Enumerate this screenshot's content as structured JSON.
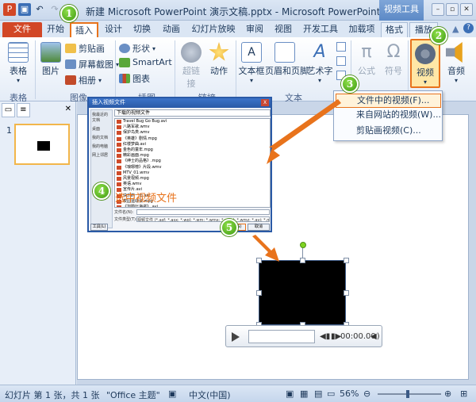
{
  "titlebar": {
    "title": "新建 Microsoft PowerPoint 演示文稿.pptx - Microsoft PowerPoint (试用",
    "context_tab": "视频工具"
  },
  "tabs": [
    "文件",
    "开始",
    "插入",
    "设计",
    "切换",
    "动画",
    "幻灯片放映",
    "审阅",
    "视图",
    "开发工具",
    "加载项",
    "格式",
    "播放"
  ],
  "ribbon": {
    "tables": {
      "btn": "表格",
      "group": "表格"
    },
    "images": {
      "picture": "图片",
      "clipart": "剪贴画",
      "screenshot": "屏幕截图",
      "album": "相册",
      "group": "图像"
    },
    "illustrations": {
      "shapes": "形状",
      "smartart": "SmartArt",
      "chart": "图表",
      "group": "插图"
    },
    "links": {
      "hyperlink": "超链接",
      "action": "动作",
      "group": "链接"
    },
    "text": {
      "textbox": "文本框",
      "header_footer": "页眉和页脚",
      "wordart": "艺术字",
      "group": "文本"
    },
    "symbols": {
      "equation": "公式",
      "symbol": "符号"
    },
    "media": {
      "video": "视频",
      "audio": "音频"
    }
  },
  "video_menu": [
    "文件中的视频(F)...",
    "来自网站的视频(W)...",
    "剪贴画视频(C)..."
  ],
  "dialog": {
    "title": "插入视频文件",
    "close": "X",
    "path": "下载的视频文件",
    "sidebar": [
      "我最近的文档",
      "桌面",
      "我的文档",
      "我的电脑",
      "网上邻居"
    ],
    "files": [
      "Travel Bug Go Bug.avi",
      "八路军歌.wmv",
      "保护鸟类.wmv",
      "《英雄》剧情.mpg",
      "红楼梦曲.avi",
      "金色的童年.mpg",
      "精彩画面.mpg",
      "《绅士的品格》.mpg",
      "《琅琊榜》片段.wmv",
      "MTV_01.wmv",
      "风景视频.mpg",
      "英语.wmv",
      "宣传片.avi",
      "快乐的一天.avi",
      "校园运动会.mpg",
      "《加勒比海盗》.avi",
      "我的视频文件.wmv"
    ],
    "filename_label": "文件名(N):",
    "filetype_label": "文件类型(T):",
    "filetype_value": "视频文件 (*.asf; *.asx; *.wpl; *.wm; *.wmx; *.wmd; *.wmz; *.avi; *.mpg; *.mpeg; *.wmv)",
    "tools": "工具(L)",
    "insert": "插入(S)",
    "cancel": "取消"
  },
  "annotations": {
    "steps": [
      "1",
      "2",
      "3",
      "4",
      "5"
    ],
    "callout": "选中视频文件",
    "color": "#e8731c"
  },
  "slides_panel": {
    "slide_number": "1"
  },
  "player": {
    "time": "00:00.00"
  },
  "status": {
    "slide": "幻灯片 第 1 张，共 1 张",
    "theme": "\"Office 主题\"",
    "lang": "中文(中国)",
    "zoom": "56%"
  }
}
